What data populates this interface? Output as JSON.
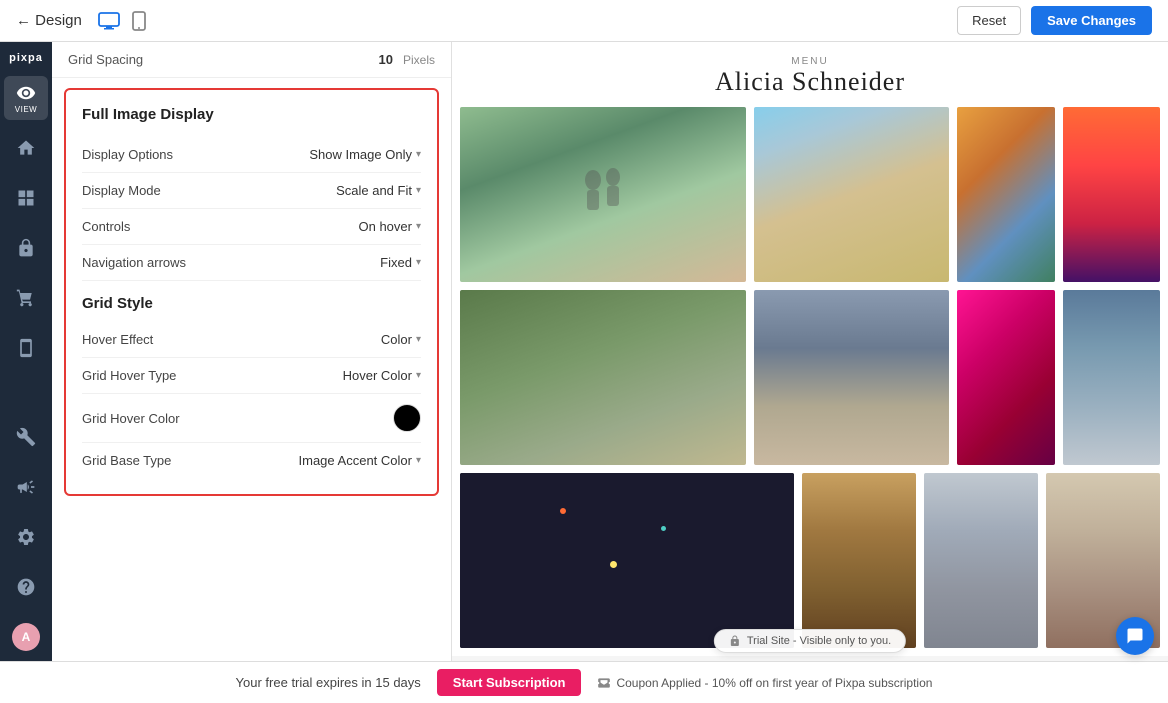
{
  "topbar": {
    "back_label": "← Design",
    "reset_label": "Reset",
    "save_label": "Save Changes"
  },
  "spacing": {
    "label": "Grid Spacing",
    "value": "10",
    "unit": "Pixels"
  },
  "panel": {
    "full_image_section": "Full Image Display",
    "display_options_label": "Display Options",
    "display_options_value": "Show Image Only",
    "display_mode_label": "Display Mode",
    "display_mode_value": "Scale and Fit",
    "controls_label": "Controls",
    "controls_value": "On hover",
    "nav_arrows_label": "Navigation arrows",
    "nav_arrows_value": "Fixed",
    "grid_style_section": "Grid Style",
    "hover_effect_label": "Hover Effect",
    "hover_effect_value": "Color",
    "grid_hover_type_label": "Grid Hover Type",
    "grid_hover_type_value": "Hover Color",
    "grid_hover_color_label": "Grid Hover Color",
    "grid_hover_color": "#000000",
    "grid_base_type_label": "Grid Base Type",
    "grid_base_type_value": "Image Accent Color"
  },
  "site": {
    "menu_label": "MENU",
    "title": "Alicia Schneider"
  },
  "trial": {
    "text": "Your free trial expires in 15 days",
    "start_sub": "Start Subscription",
    "coupon": "Coupon Applied - 10% off on first year of Pixpa subscription"
  },
  "trial_badge": "Trial Site - Visible only to you.",
  "icons": {
    "view": "VIEW",
    "home": "⌂",
    "layout": "▤",
    "lock": "🔒",
    "cart": "🛒",
    "mobile": "📱",
    "tools": "✂",
    "megaphone": "📣",
    "gear": "⚙",
    "question": "?",
    "avatar": "A"
  }
}
